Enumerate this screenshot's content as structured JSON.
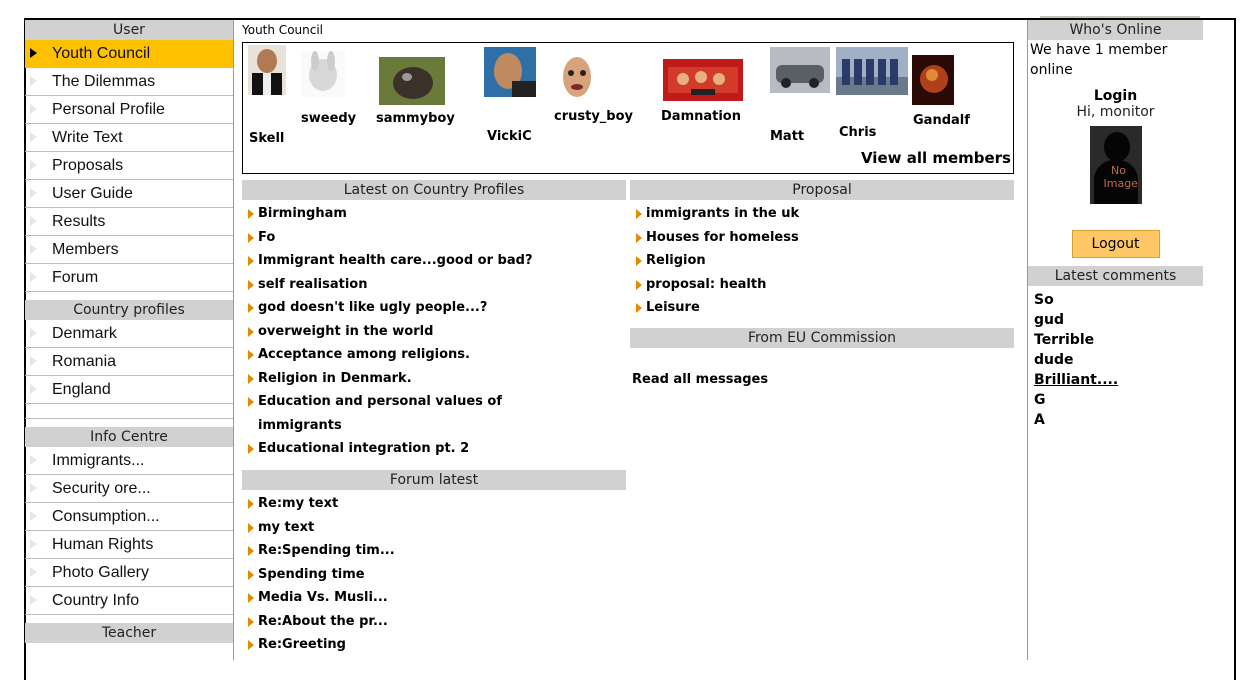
{
  "sidebar": {
    "user_header": "User",
    "user_items": [
      "Youth Council",
      "The Dilemmas",
      "Personal Profile",
      "Write Text",
      "Proposals",
      "User Guide",
      "Results",
      "Members",
      "Forum"
    ],
    "country_header": "Country profiles",
    "country_items": [
      "Denmark",
      "Romania",
      "England"
    ],
    "info_header": "Info Centre",
    "info_items": [
      "Immigrants...",
      "Security ore...",
      "Consumption...",
      "Human Rights",
      "Photo Gallery",
      "Country Info"
    ],
    "teacher_header": "Teacher"
  },
  "center": {
    "title": "Youth Council",
    "members": [
      "Skell",
      "sweedy",
      "sammyboy",
      "VickiC",
      "crusty_boy",
      "Damnation",
      "Matt",
      "Chris",
      "Gandalf"
    ],
    "view_all": "View all members",
    "country_header": "Latest on Country Profiles",
    "country_items": [
      "Birmingham",
      "Fo",
      "Immigrant health care...good or bad?",
      "self realisation",
      "god doesn't like ugly people...?",
      "overweight in the world",
      "Acceptance among religions.",
      "Religion in Denmark.",
      "Education and personal values of",
      "immigrants",
      "Educational integration pt. 2"
    ],
    "proposal_header": "Proposal",
    "proposal_items": [
      "immigrants in the uk",
      "Houses for homeless",
      "Religion",
      "proposal: health",
      "Leisure"
    ],
    "eu_header": "From EU Commission",
    "read_all": "Read all messages",
    "forum_header": "Forum latest",
    "forum_items": [
      "Re:my text",
      "my text",
      "Re:Spending tim...",
      "Spending time",
      "Media Vs. Musli...",
      "Re:About the pr...",
      "Re:Greeting"
    ]
  },
  "right": {
    "online_header": "Who's Online",
    "online_text": "We have 1 member online",
    "login_label": "Login",
    "hi_text": "Hi, monitor",
    "no_image_text": "No Image",
    "logout_label": "Logout",
    "comments_header": "Latest comments",
    "comments": [
      "So",
      "gud",
      "Terrible",
      "dude",
      "Brilliant....",
      "G",
      "A"
    ]
  },
  "colors": {
    "accent": "#ffc000",
    "header_gray": "#d1d1d1",
    "arrow": "#e58a00",
    "logout": "#ffc766"
  }
}
